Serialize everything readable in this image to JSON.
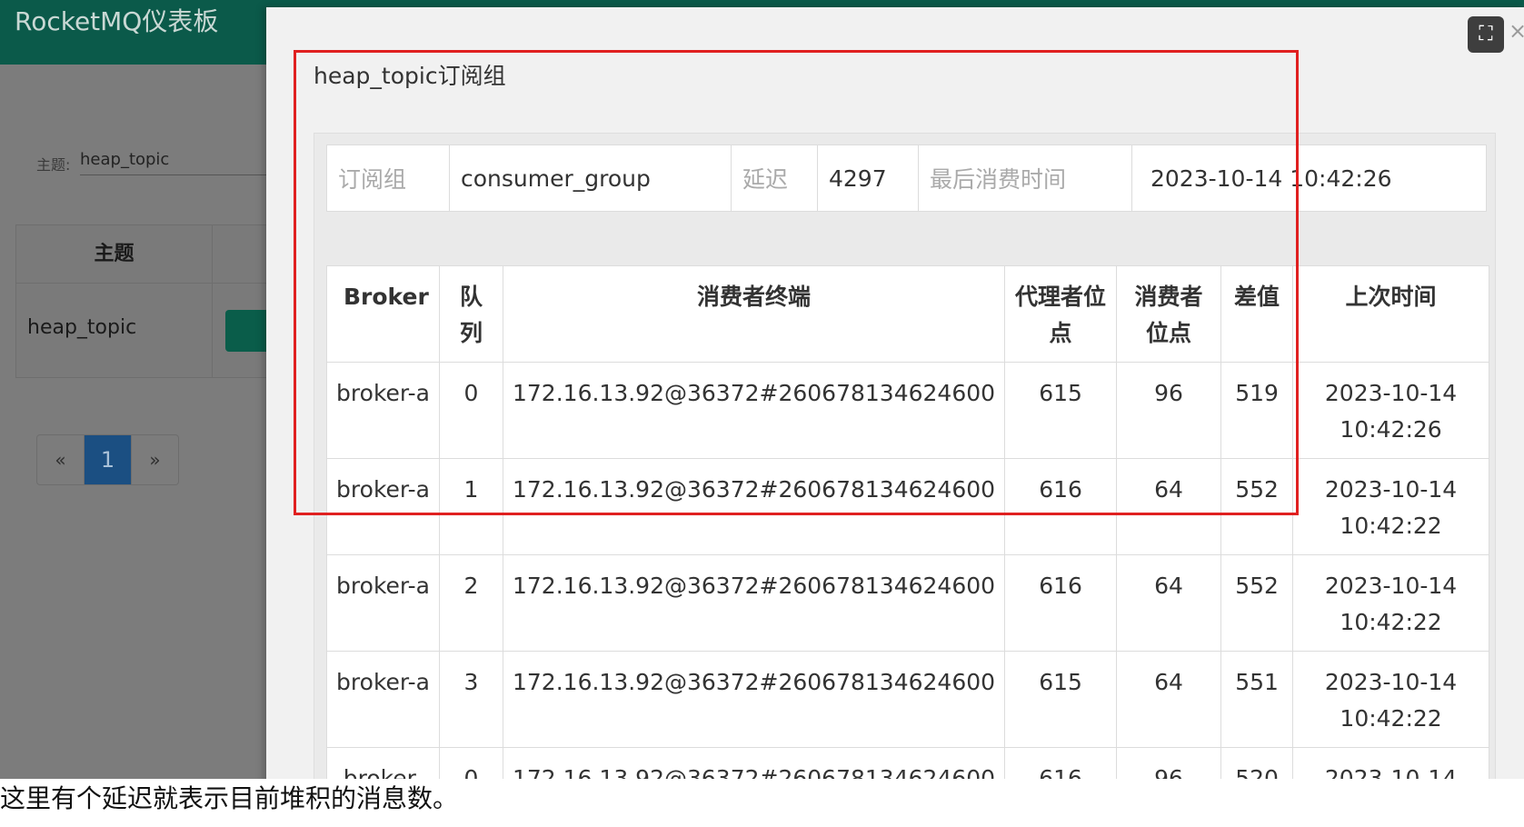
{
  "app": {
    "title": "RocketMQ仪表板"
  },
  "filter": {
    "label": "主题:",
    "value": "heap_topic"
  },
  "topic_table": {
    "header": "主题",
    "row_topic": "heap_topic"
  },
  "pagination": {
    "prev": "«",
    "current": "1",
    "next": "»"
  },
  "modal": {
    "title": "heap_topic订阅组",
    "summary": {
      "group_label": "订阅组",
      "group_value": "consumer_group",
      "delay_label": "延迟",
      "delay_value": "4297",
      "last_label": "最后消费时间",
      "last_value": "2023-10-14 10:42:26"
    },
    "columns": [
      "Broker",
      "队列",
      "消费者终端",
      "代理者位点",
      "消费者位点",
      "差值",
      "上次时间"
    ],
    "rows": [
      {
        "broker": "broker-a",
        "queue": "0",
        "client": "172.16.13.92@36372#260678134624600",
        "broker_offset": "615",
        "consumer_offset": "96",
        "diff": "519",
        "time": "2023-10-14 10:42:26"
      },
      {
        "broker": "broker-a",
        "queue": "1",
        "client": "172.16.13.92@36372#260678134624600",
        "broker_offset": "616",
        "consumer_offset": "64",
        "diff": "552",
        "time": "2023-10-14 10:42:22"
      },
      {
        "broker": "broker-a",
        "queue": "2",
        "client": "172.16.13.92@36372#260678134624600",
        "broker_offset": "616",
        "consumer_offset": "64",
        "diff": "552",
        "time": "2023-10-14 10:42:22"
      },
      {
        "broker": "broker-a",
        "queue": "3",
        "client": "172.16.13.92@36372#260678134624600",
        "broker_offset": "615",
        "consumer_offset": "64",
        "diff": "551",
        "time": "2023-10-14 10:42:22"
      },
      {
        "broker": "broker-",
        "queue": "0",
        "client": "172.16.13.92@36372#260678134624600",
        "broker_offset": "616",
        "consumer_offset": "96",
        "diff": "520",
        "time": "2023-10-14"
      }
    ],
    "expand_icon": "⛶",
    "close_icon": "×"
  },
  "caption": "这里有个延迟就表示目前堆积的消息数。"
}
